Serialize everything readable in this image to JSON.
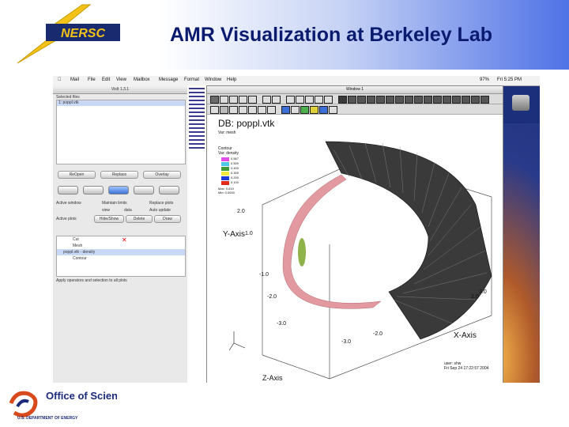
{
  "slide": {
    "title": "AMR Visualization at Berkeley Lab",
    "logo_nersc": "NERSC",
    "logo_office": "Office of Science",
    "logo_office_sub": "U.S. DEPARTMENT OF ENERGY"
  },
  "menubar": {
    "items": [
      "Mail",
      "File",
      "Edit",
      "View",
      "Mailbox",
      "Message",
      "Format",
      "Window",
      "Help"
    ],
    "battery": "97%",
    "clock": "Fri 5:25 PM"
  },
  "gui_window": {
    "title": "VisIt 1.3.1",
    "selected_files_label": "Selected files",
    "file_item": "1: poppl.vtk",
    "buttons": {
      "reopen": "ReOpen",
      "replace": "Replace",
      "overlay": "Overlay"
    },
    "active_window_label": "Active window",
    "maintain_limits_label": "Maintain limits",
    "replace_plots_label": "Replace plots",
    "view_label": "view",
    "data_label": "data",
    "auto_update_label": "Auto update",
    "active_plots_label": "Active plots",
    "hide_show": "Hide/Show",
    "delete": "Delete",
    "draw": "Draw",
    "plots": [
      "Cut",
      "Mesh",
      "poppl.vtk - density",
      "Contour"
    ],
    "apply_ops_label": "Apply operators and selection to all plots"
  },
  "viz_window": {
    "title": "Window 1",
    "db_label": "DB: poppl.vtk",
    "var_label": "Var: mesh",
    "legend_title": "Contour",
    "legend_sub": "Var: density",
    "legend_values": [
      "0.567",
      "0.500",
      "0.400",
      "0.300",
      "0.200",
      "0.100"
    ],
    "legend_max": "Max: 0.610",
    "legend_min": "Min: 0.0000",
    "y_axis_label": "Y-Axis",
    "x_axis_label": "X-Axis",
    "z_axis_label": "Z-Axis",
    "y_ticks": [
      "2.0",
      "1.0",
      "-1.0",
      "-2.0",
      "-3.0"
    ],
    "x_ticks": [
      "-3.0",
      "-2.0",
      "2.0",
      "3.0"
    ],
    "user_label": "user: shw",
    "date_label": "Fri Sep 24 17:22:57 2004",
    "legend_colors": [
      "#e24de8",
      "#4ec7e6",
      "#3f9a3a",
      "#f2e93b",
      "#1f3ad6",
      "#e22a1a"
    ]
  }
}
